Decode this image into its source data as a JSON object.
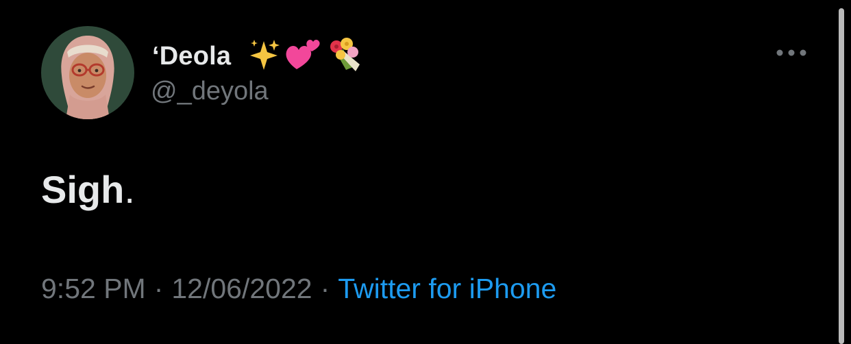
{
  "tweet": {
    "author": {
      "display_name": "‘Deola",
      "handle": "@_deyola",
      "name_emojis": [
        "sparkles-emoji",
        "two-hearts-emoji",
        "bouquet-emoji"
      ]
    },
    "text": "Sigh",
    "text_punctuation": ".",
    "time": "9:52 PM",
    "separator": "·",
    "date": "12/06/2022",
    "source": "Twitter for iPhone"
  },
  "icons": {
    "more": "more-dots-icon"
  },
  "colors": {
    "background": "#000000",
    "primary_text": "#e7e9ea",
    "secondary_text": "#71767b",
    "link": "#1d9bf0"
  }
}
